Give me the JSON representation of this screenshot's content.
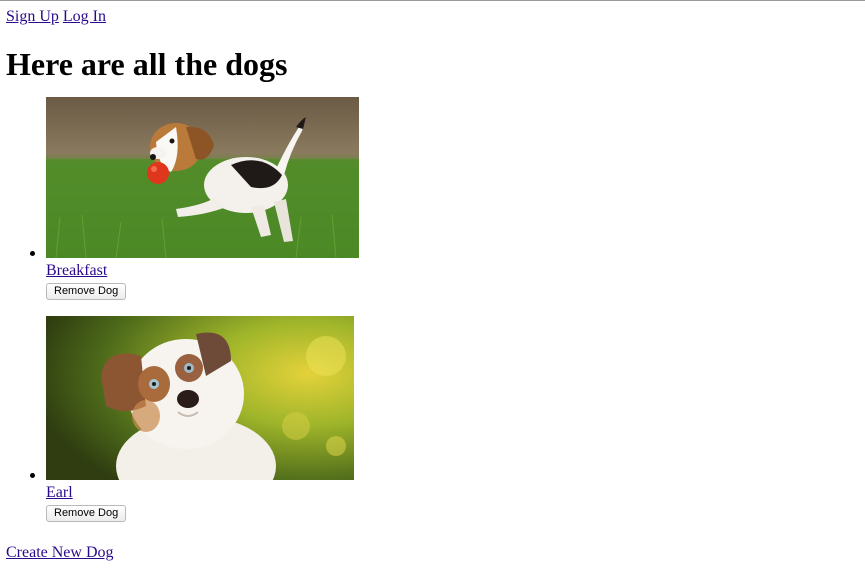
{
  "nav": {
    "signup_label": "Sign Up",
    "login_label": "Log In"
  },
  "page_title": "Here are all the dogs",
  "dogs": [
    {
      "name": "Breakfast",
      "remove_label": "Remove Dog"
    },
    {
      "name": "Earl",
      "remove_label": "Remove Dog"
    }
  ],
  "create_label": "Create New Dog",
  "colors": {
    "link": "#2a0a8c",
    "text": "#000000",
    "background": "#ffffff"
  }
}
